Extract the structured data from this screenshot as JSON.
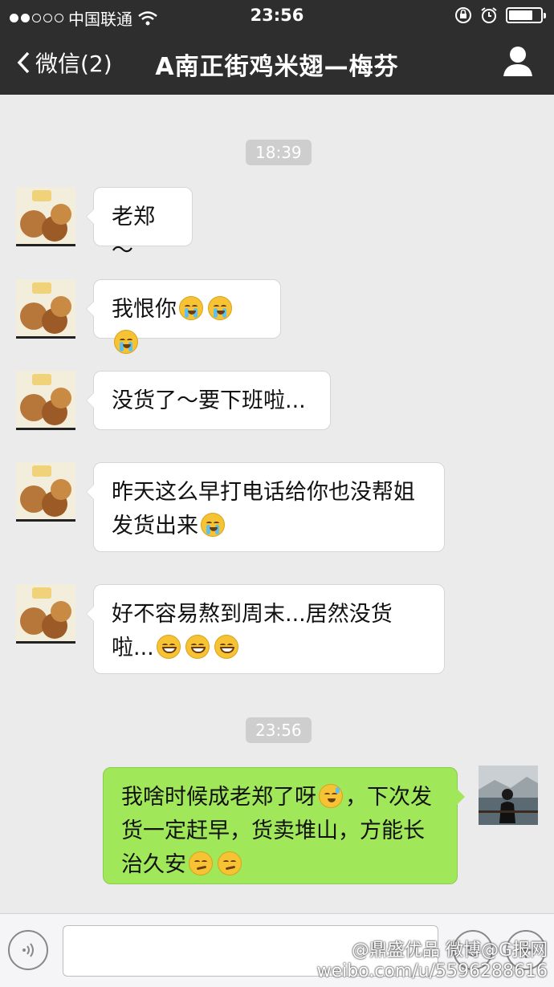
{
  "status": {
    "carrier": "中国联通",
    "time": "23:56"
  },
  "nav": {
    "back_label": "微信(2)",
    "title": "A南正街鸡米翅—梅芬"
  },
  "timestamps": [
    "18:39",
    "23:56"
  ],
  "messages": [
    {
      "from": "them",
      "text": "老郑～",
      "emoji": []
    },
    {
      "from": "them",
      "text": "我恨你",
      "emoji": [
        "crying-face",
        "crying-face",
        "crying-face"
      ]
    },
    {
      "from": "them",
      "text": "没货了～要下班啦...",
      "emoji": []
    },
    {
      "from": "them",
      "text": "昨天这么早打电话给你也没帮姐发货出来",
      "emoji": [
        "crying-face"
      ]
    },
    {
      "from": "them",
      "text": "好不容易熬到周末...居然没货啦...",
      "emoji": [
        "grinning-sweat-face",
        "grinning-sweat-face",
        "grinning-sweat-face"
      ]
    },
    {
      "from": "me",
      "text_a": "我啥时候成老郑了呀",
      "text_b": "，下次发货一定赶早，货卖堆山，方能长治久安",
      "emoji_mid": [
        "sweating-face"
      ],
      "emoji": [
        "smirk-face",
        "smirk-face"
      ]
    }
  ],
  "watermark": {
    "line1": "@鼎盛优品 微博@G报网",
    "line2": "weibo.com/u/5596288616"
  },
  "colors": {
    "topbar": "#2e2e2e",
    "background": "#ebebeb",
    "outgoing_bubble": "#a0e75a",
    "incoming_bubble": "#ffffff"
  }
}
